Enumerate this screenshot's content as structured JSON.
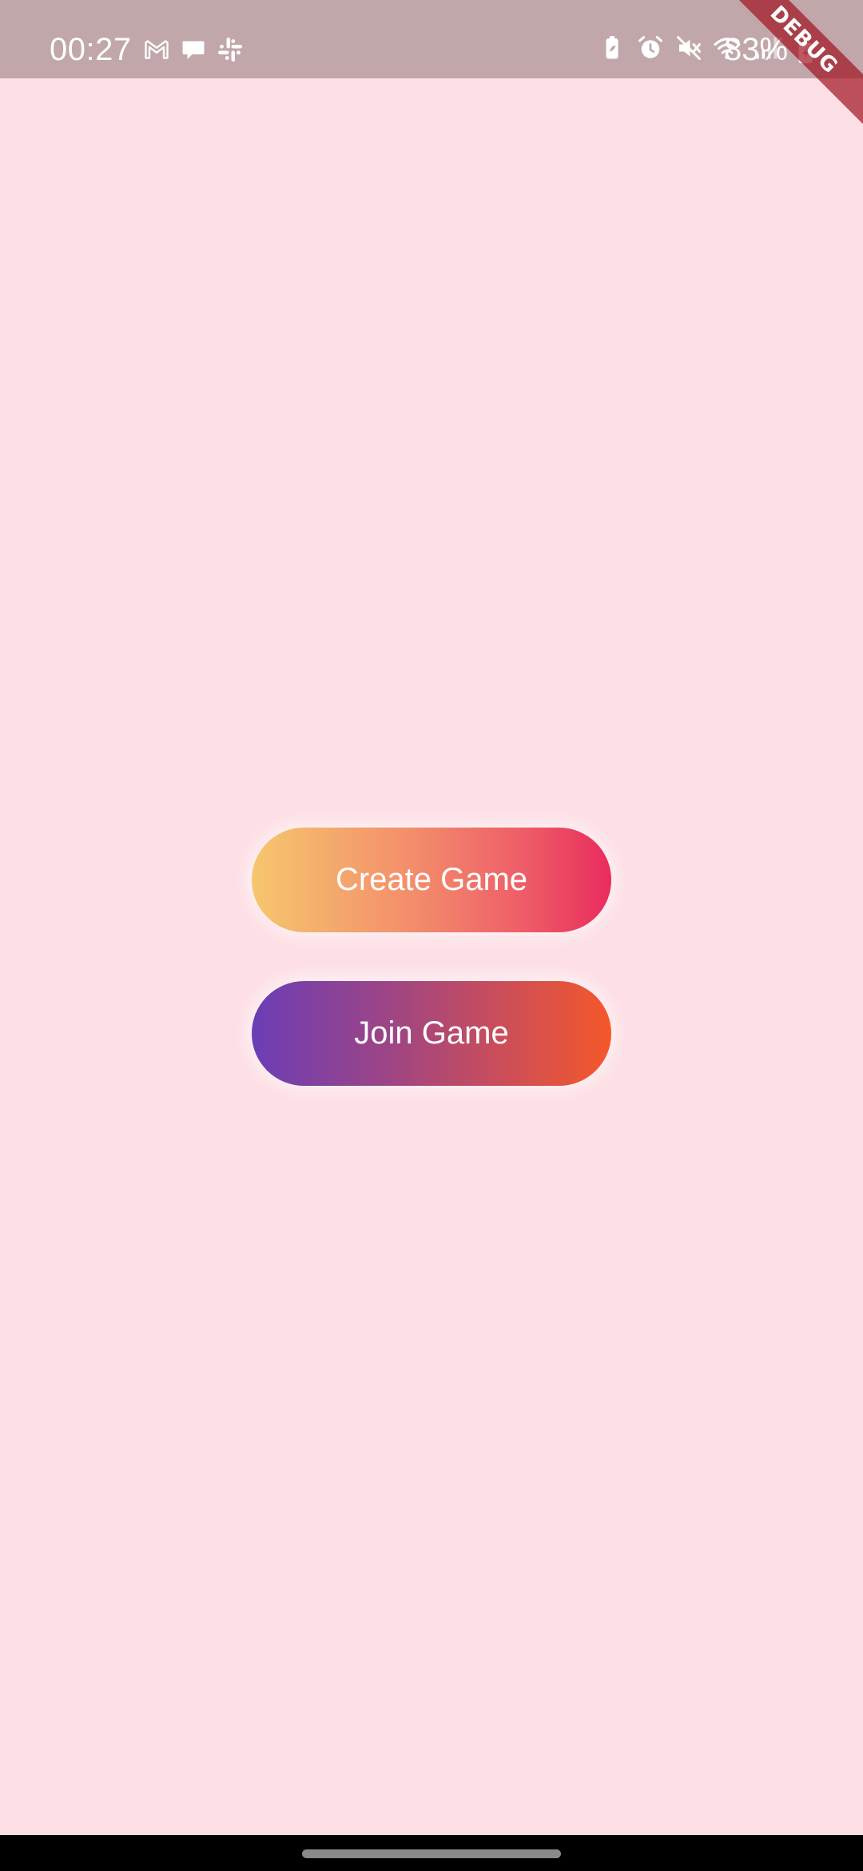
{
  "status_bar": {
    "time": "00:27",
    "battery": "83%",
    "left_icons": [
      "gmail-icon",
      "chat-bubble-icon",
      "slack-icon"
    ],
    "right_icons": [
      "battery-saver-icon",
      "alarm-icon",
      "mute-icon",
      "wifi-icon",
      "signal-icon"
    ],
    "background": "#c1a6aa"
  },
  "debug_banner": {
    "label": "DEBUG"
  },
  "main": {
    "background": "#fde0e6",
    "buttons": [
      {
        "label": "Create Game",
        "gradient": [
          "#f6c66d",
          "#e92c5d"
        ]
      },
      {
        "label": "Join Game",
        "gradient": [
          "#6b3db6",
          "#f4582a"
        ]
      }
    ]
  }
}
